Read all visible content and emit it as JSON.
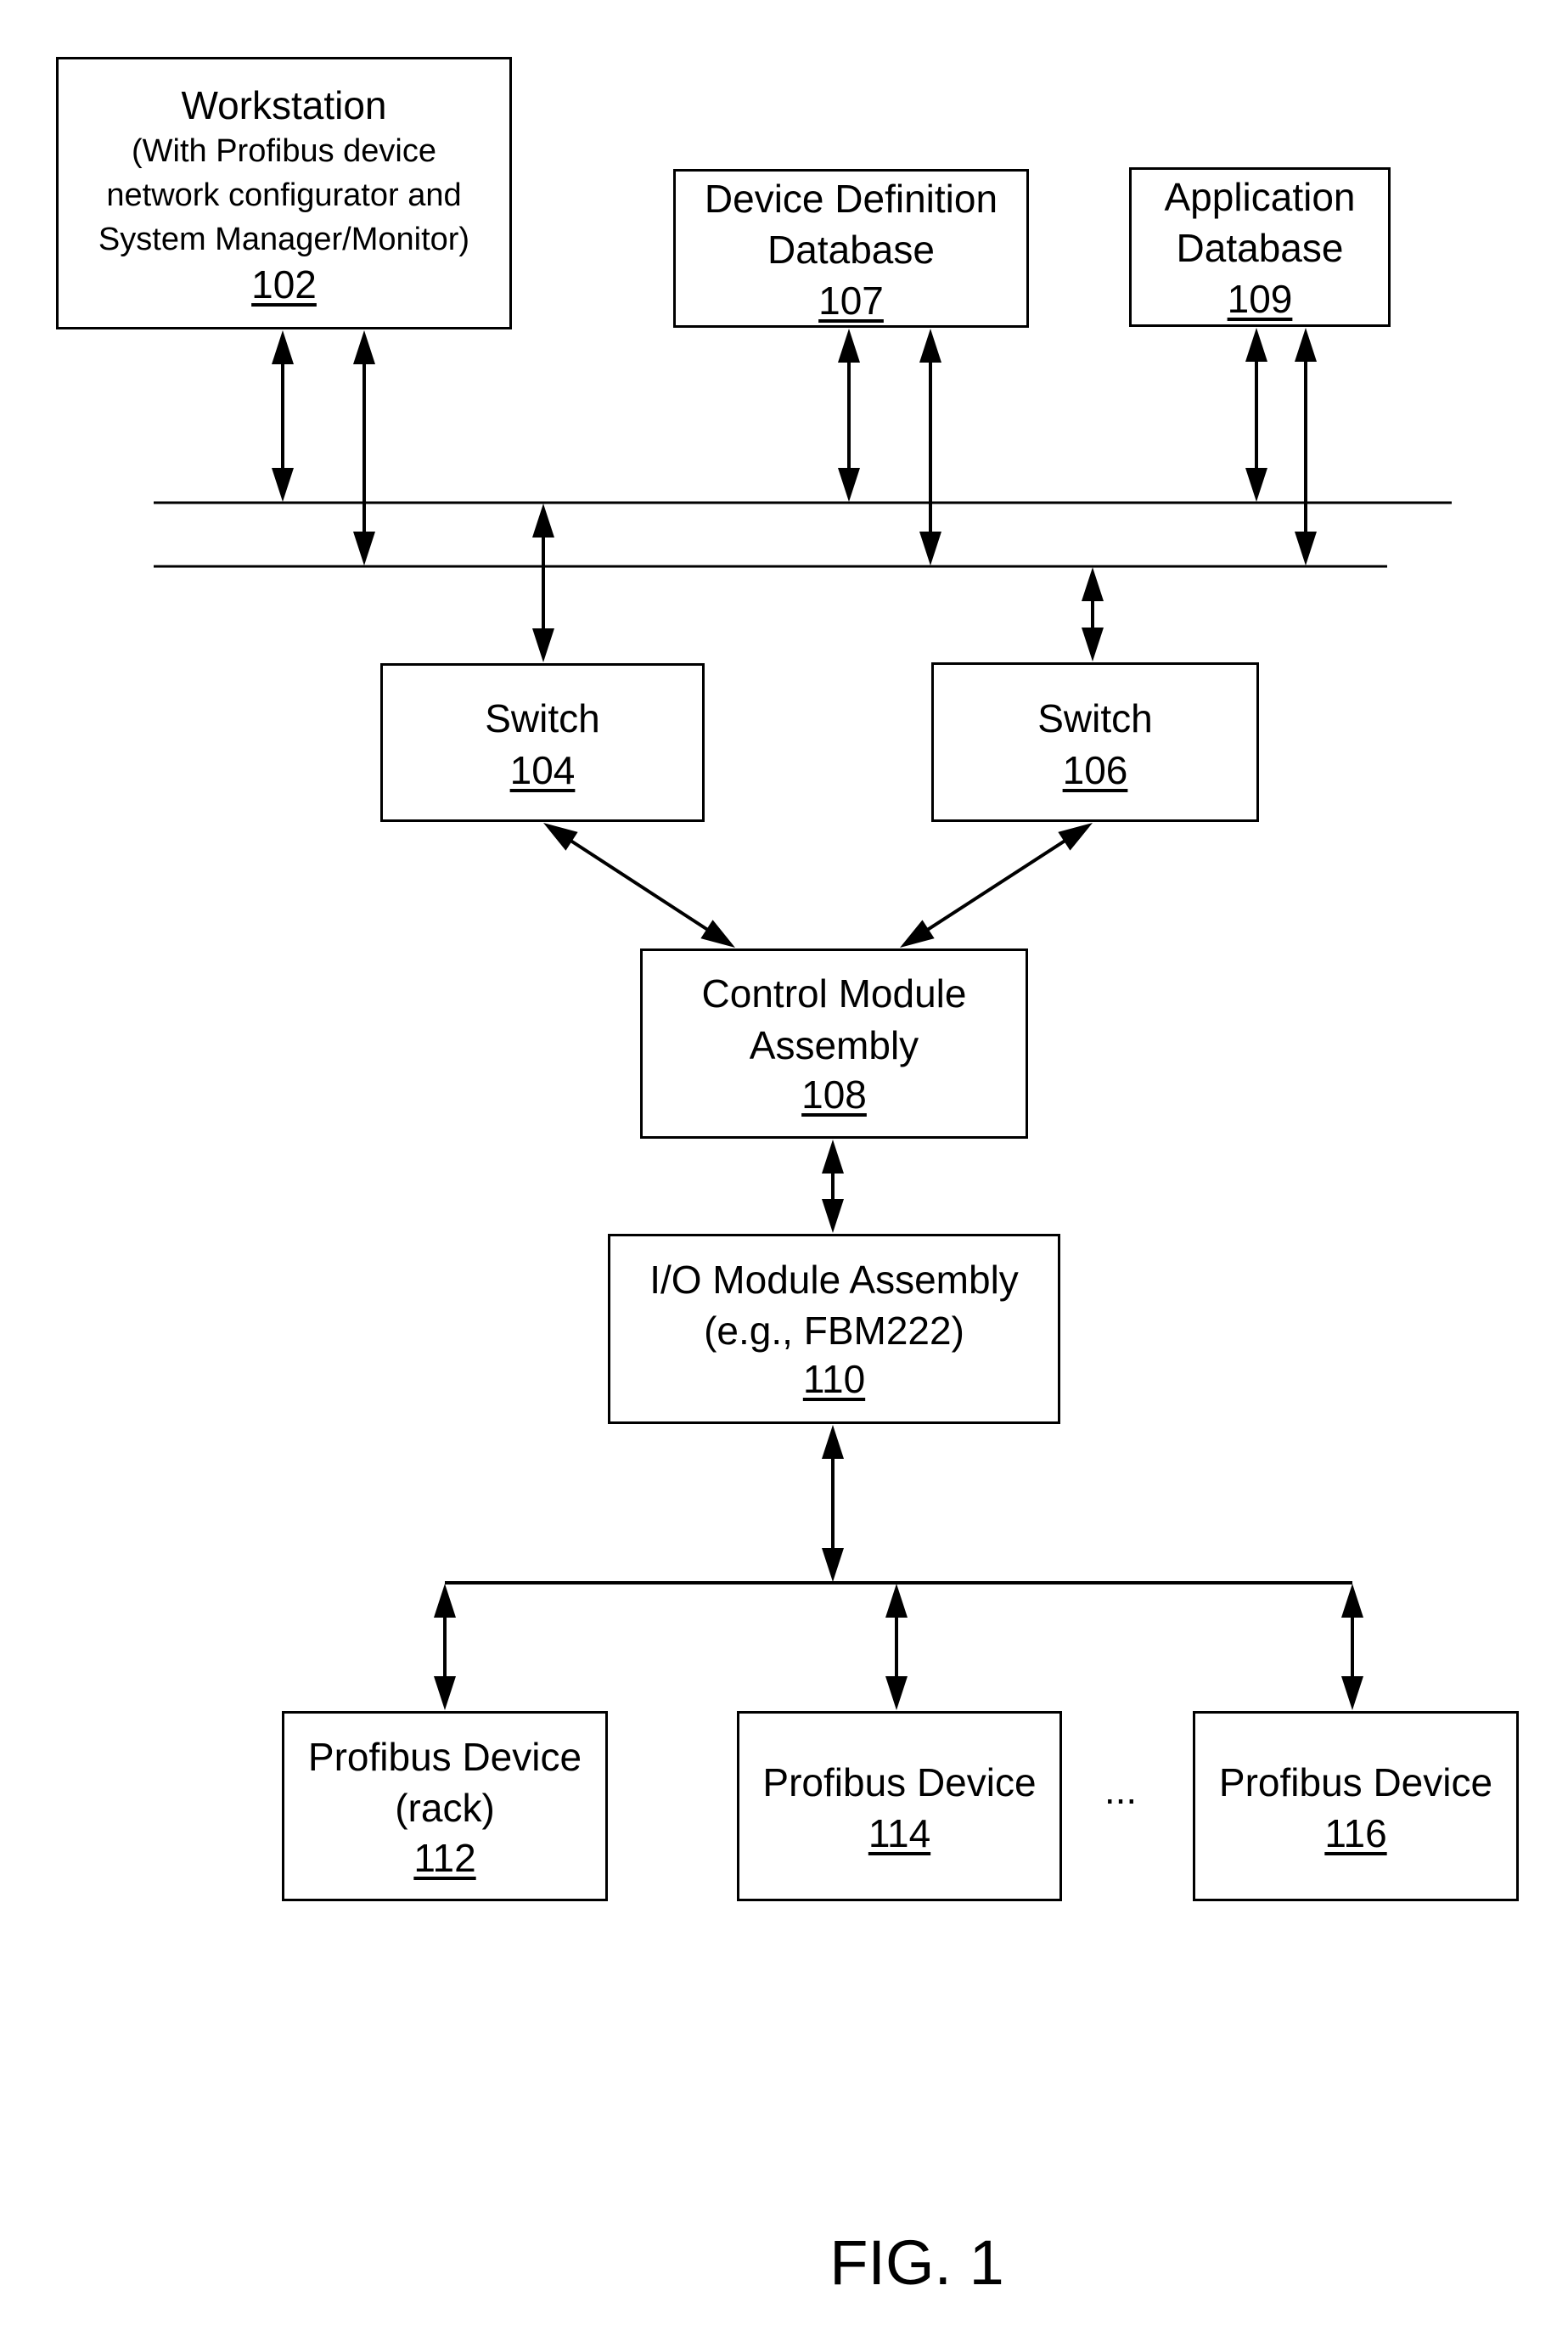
{
  "figure": {
    "label": "FIG. 1",
    "ellipsis": "..."
  },
  "nodes": {
    "workstation": {
      "title": "Workstation",
      "subtitle": [
        "(With Profibus device",
        "network configurator and",
        "System Manager/Monitor)"
      ],
      "ref": "102"
    },
    "device_definition_db": {
      "lines": [
        "Device Definition",
        "Database"
      ],
      "ref": "107"
    },
    "application_db": {
      "lines": [
        "Application",
        "Database"
      ],
      "ref": "109"
    },
    "switch_104": {
      "lines": [
        "Switch"
      ],
      "ref": "104"
    },
    "switch_106": {
      "lines": [
        "Switch"
      ],
      "ref": "106"
    },
    "control_module_assembly": {
      "lines": [
        "Control Module",
        "Assembly"
      ],
      "ref": "108"
    },
    "io_module_assembly": {
      "lines": [
        "I/O Module Assembly",
        "(e.g., FBM222)"
      ],
      "ref": "110"
    },
    "profibus_device_112": {
      "lines": [
        "Profibus Device",
        "(rack)"
      ],
      "ref": "112"
    },
    "profibus_device_114": {
      "lines": [
        "Profibus Device"
      ],
      "ref": "114"
    },
    "profibus_device_116": {
      "lines": [
        "Profibus Device"
      ],
      "ref": "116"
    }
  },
  "connections": [
    {
      "from": "workstation",
      "to": "network-bus-1",
      "type": "bidirectional"
    },
    {
      "from": "workstation",
      "to": "network-bus-2",
      "type": "bidirectional"
    },
    {
      "from": "device_definition_db",
      "to": "network-bus-1",
      "type": "bidirectional"
    },
    {
      "from": "device_definition_db",
      "to": "network-bus-2",
      "type": "bidirectional"
    },
    {
      "from": "application_db",
      "to": "network-bus-1",
      "type": "bidirectional"
    },
    {
      "from": "application_db",
      "to": "network-bus-2",
      "type": "bidirectional"
    },
    {
      "from": "network-bus-1",
      "to": "switch_104",
      "type": "bidirectional"
    },
    {
      "from": "network-bus-2",
      "to": "switch_106",
      "type": "bidirectional"
    },
    {
      "from": "switch_104",
      "to": "control_module_assembly",
      "type": "bidirectional"
    },
    {
      "from": "switch_106",
      "to": "control_module_assembly",
      "type": "bidirectional"
    },
    {
      "from": "control_module_assembly",
      "to": "io_module_assembly",
      "type": "bidirectional"
    },
    {
      "from": "io_module_assembly",
      "to": "profibus-bus",
      "type": "bidirectional"
    },
    {
      "from": "profibus-bus",
      "to": "profibus_device_112",
      "type": "bidirectional"
    },
    {
      "from": "profibus-bus",
      "to": "profibus_device_114",
      "type": "bidirectional"
    },
    {
      "from": "profibus-bus",
      "to": "profibus_device_116",
      "type": "bidirectional"
    }
  ]
}
